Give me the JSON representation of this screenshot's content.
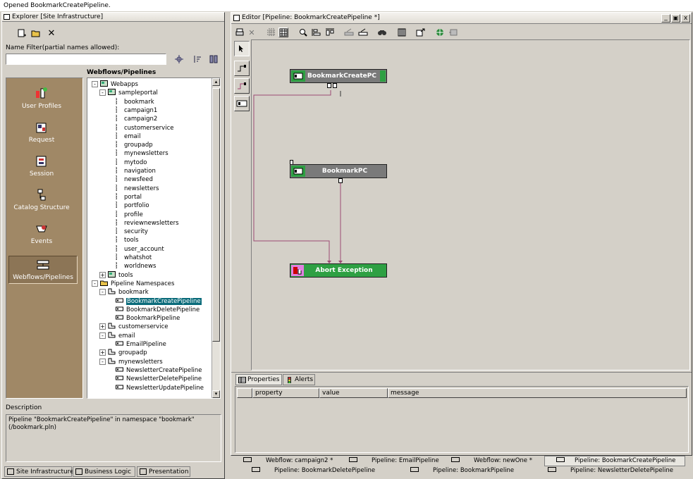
{
  "status": {
    "message": "Opened BookmarkCreatePipeline."
  },
  "explorer": {
    "title": "Explorer [Site Infrastructure]",
    "filter_label": "Name Filter(partial names allowed):",
    "filter_value": "",
    "tree_header": "Webflows/Pipelines",
    "description_label": "Description",
    "description_text": "Pipeline \"BookmarkCreatePipeline\" in namespace \"bookmark\" (/bookmark.pln)",
    "nav": [
      {
        "label": "User Profiles"
      },
      {
        "label": "Request"
      },
      {
        "label": "Session"
      },
      {
        "label": "Catalog Structure"
      },
      {
        "label": "Events"
      },
      {
        "label": "Webflows/Pipelines"
      }
    ],
    "tree": {
      "webapps": "Webapps",
      "sampleportal": "sampleportal",
      "sample_items": [
        "bookmark",
        "campaign1",
        "campaign2",
        "customerservice",
        "email",
        "groupadp",
        "mynewsletters",
        "mytodo",
        "navigation",
        "newsfeed",
        "newsletters",
        "portal",
        "portfolio",
        "profile",
        "reviewnewsletters",
        "security",
        "tools",
        "user_account",
        "whatshot",
        "worldnews"
      ],
      "tools": "tools",
      "pipeline_namespaces": "Pipeline Namespaces",
      "bookmark": "bookmark",
      "bookmark_items": [
        "BookmarkCreatePipeline",
        "BookmarkDeletePipeline",
        "BookmarkPipeline"
      ],
      "customerservice": "customerservice",
      "email": "email",
      "email_items": [
        "EmailPipeline"
      ],
      "groupadp": "groupadp",
      "mynewsletters": "mynewsletters",
      "mynewsletters_items": [
        "NewsletterCreatePipeline",
        "NewsletterDeletePipeline",
        "NewsletterUpdatePipeline"
      ]
    },
    "bottom_tabs": [
      "Site Infrastructure",
      "Business Logic",
      "Presentation"
    ]
  },
  "editor": {
    "title": "Editor [Pipeline: BookmarkCreatePipeline *]",
    "window_buttons": [
      "_",
      "▣",
      "x"
    ],
    "nodes": {
      "bookmark_create_pc": "BookmarkCreatePC",
      "bookmark_pc": "BookmarkPC",
      "abort_exception": "Abort Exception"
    },
    "colors": {
      "node_gray": "#7a7a7a",
      "node_green": "#2ea043",
      "connector": "#9b4a74",
      "canvas": "#d4d0c8"
    },
    "properties_tab": "Properties",
    "alerts_tab": "Alerts",
    "columns": [
      "property",
      "value",
      "message"
    ]
  },
  "doc_tabs": {
    "row1": [
      "Webflow: campaign2 *",
      "Pipeline: EmailPipeline",
      "Webflow: newOne *",
      "Pipeline: BookmarkCreatePipeline"
    ],
    "row2": [
      "Pipeline: BookmarkDeletePipeline",
      "Pipeline: BookmarkPipeline",
      "Pipeline: NewsletterDeletePipeline"
    ]
  }
}
